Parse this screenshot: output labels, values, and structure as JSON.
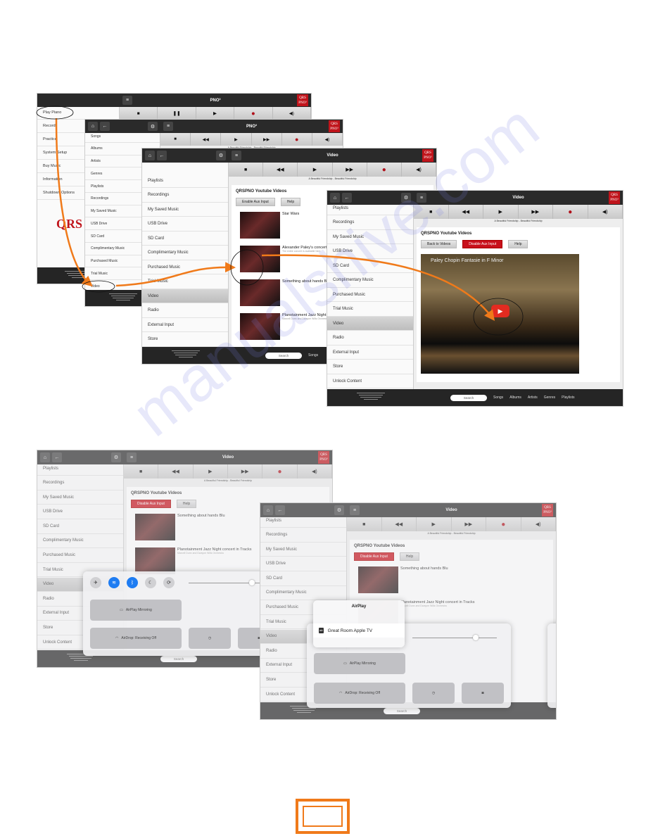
{
  "colors": {
    "accent": "#f07a1a",
    "qrs_red": "#c0141b",
    "titlebar": "#2a2a2a",
    "toggle_on": "#1e7cf2"
  },
  "logo": {
    "top": "QRS",
    "bottom": "PNO³"
  },
  "watermark": "manualshive.com",
  "screens": {
    "a": {
      "title": "PNO³",
      "menu": [
        "Play Piano",
        "Record",
        "Practice",
        "System Setup",
        "Buy Music",
        "Information",
        "Shutdown Options"
      ],
      "brand": "QRS",
      "transport": [
        "stop",
        "pause",
        "play",
        "record",
        "volume"
      ]
    },
    "b": {
      "title": "PNO³",
      "menu": [
        "Songs",
        "Albums",
        "Artists",
        "Genres",
        "Playlists",
        "Recordings",
        "My Saved Music",
        "USB Drive",
        "SD Card",
        "Complimentary Music",
        "Purchased Music",
        "Trial Music",
        "Video"
      ],
      "transport": [
        "stop",
        "rewind",
        "play",
        "fast-forward",
        "record",
        "volume"
      ],
      "now_playing": "A Beautiful Friendship - Beautiful Friendship"
    },
    "c": {
      "title": "Video",
      "menu": [
        "Playlists",
        "Recordings",
        "My Saved Music",
        "USB Drive",
        "SD Card",
        "Complimentary Music",
        "Purchased Music",
        "Trial Music",
        "Video",
        "Radio",
        "External Input",
        "Store",
        "Unlock Content"
      ],
      "selected": 8,
      "transport": [
        "stop",
        "rewind",
        "play",
        "fast-forward",
        "record",
        "volume"
      ],
      "now_playing": "A Beautiful Friendship - Beautiful Friendship",
      "heading": "QRSPNO Youtube Videos",
      "buttons": [
        {
          "label": "Enable Aux Input",
          "red": false
        },
        {
          "label": "Help",
          "red": false
        }
      ],
      "videos": [
        {
          "title": "Star Wars",
          "desc": ""
        },
        {
          "title": "Alexander Paley's concert in",
          "desc": "The entire concert is available here"
        },
        {
          "title": "Something about hands Blu",
          "desc": ""
        },
        {
          "title": "Planotainment Jazz Night concert in",
          "desc": "Marcell Dunn and Dwayne Wills Orchestra"
        }
      ],
      "search": "Search",
      "links": [
        "Songs"
      ]
    },
    "d": {
      "title": "Video",
      "menu": [
        "Playlists",
        "Recordings",
        "My Saved Music",
        "USB Drive",
        "SD Card",
        "Complimentary Music",
        "Purchased Music",
        "Trial Music",
        "Video",
        "Radio",
        "External Input",
        "Store",
        "Unlock Content"
      ],
      "selected": 8,
      "transport": [
        "stop",
        "rewind",
        "play",
        "fast-forward",
        "record",
        "volume"
      ],
      "now_playing": "A Beautiful Friendship - Beautiful Friendship",
      "heading": "QRSPNO Youtube Videos",
      "buttons": [
        {
          "label": "Back to Videos",
          "red": false
        },
        {
          "label": "Disable Aux Input",
          "red": true
        },
        {
          "label": "Help",
          "red": false
        }
      ],
      "player_title": "Paley Chopin Fantasie in F Minor",
      "search": "Search",
      "links": [
        "Songs",
        "Albums",
        "Artists",
        "Genres",
        "Playlists"
      ]
    },
    "e": {
      "title": "Video",
      "menu": [
        "Playlists",
        "Recordings",
        "My Saved Music",
        "USB Drive",
        "SD Card",
        "Complimentary Music",
        "Purchased Music",
        "Trial Music",
        "Video",
        "Radio",
        "External Input",
        "Store",
        "Unlock Content"
      ],
      "selected": 8,
      "transport": [
        "stop",
        "rewind",
        "play",
        "fast-forward",
        "record",
        "volume"
      ],
      "now_playing": "A Beautiful Friendship - Beautiful Friendship",
      "heading": "QRSPNO Youtube Videos",
      "buttons": [
        {
          "label": "Disable Aux Input",
          "red": true
        },
        {
          "label": "Help",
          "red": false
        }
      ],
      "videos": [
        {
          "title": "Something about hands Blu",
          "desc": ""
        },
        {
          "title": "Planotainment Jazz Night concert in Tracks",
          "desc": "Marcell Dunn and Dwayne Wills Orchestra"
        }
      ],
      "search": "Search",
      "links": []
    },
    "f": {
      "title": "Video",
      "menu": [
        "Playlists",
        "Recordings",
        "My Saved Music",
        "USB Drive",
        "SD Card",
        "Complimentary Music",
        "Purchased Music",
        "Trial Music",
        "Video",
        "Radio",
        "External Input",
        "Store",
        "Unlock Content"
      ],
      "selected": 8,
      "transport": [
        "stop",
        "rewind",
        "play",
        "fast-forward",
        "record",
        "volume"
      ],
      "now_playing": "A Beautiful Friendship - Beautiful Friendship",
      "heading": "QRSPNO Youtube Videos",
      "buttons": [
        {
          "label": "Disable Aux Input",
          "red": true
        },
        {
          "label": "Help",
          "red": false
        }
      ],
      "videos": [
        {
          "title": "Something about hands Blu",
          "desc": ""
        },
        {
          "title": "Planotainment Jazz Night concert in Tracks",
          "desc": "Marcell Dunn and Dwayne Wills Orchestra"
        }
      ],
      "search": "Search",
      "links": []
    }
  },
  "control_center": {
    "toggles": [
      {
        "icon": "airplane-icon",
        "on": false
      },
      {
        "icon": "wifi-icon",
        "on": true
      },
      {
        "icon": "bluetooth-icon",
        "on": true
      },
      {
        "icon": "moon-icon",
        "on": false
      },
      {
        "icon": "rotation-lock-icon",
        "on": false
      }
    ],
    "airplay_mirroring": "AirPlay Mirroring",
    "airdrop": "AirDrop: Receiving Off",
    "brightness_percent": 75
  },
  "airplay_popover": {
    "title": "AirPlay",
    "device": "Great Room Apple TV",
    "device_badge": "atv"
  }
}
